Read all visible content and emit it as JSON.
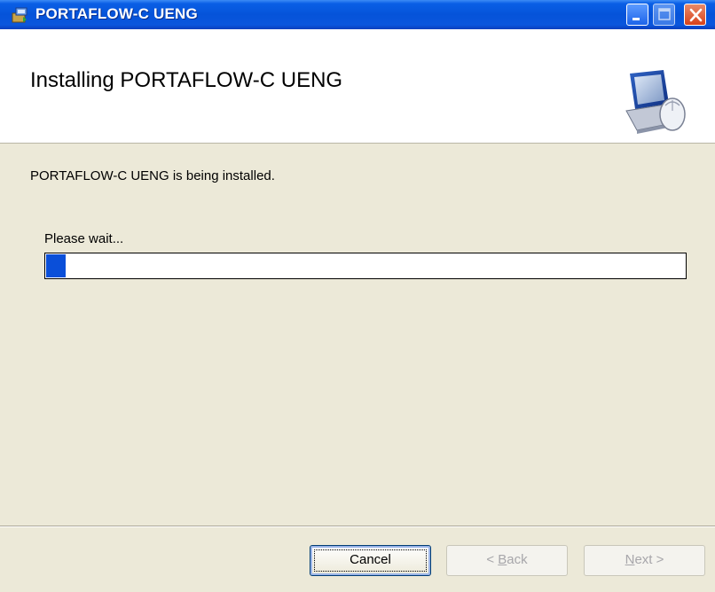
{
  "window": {
    "title": "PORTAFLOW-C UENG",
    "app_icon": "installer-package-icon",
    "controls": [
      "minimize-icon",
      "maximize-icon",
      "close-icon"
    ]
  },
  "header": {
    "title": "Installing PORTAFLOW-C UENG",
    "graphic": "computer-install-icon"
  },
  "main": {
    "status": "PORTAFLOW-C UENG is being installed.",
    "wait_label": "Please wait...",
    "progress_fraction": 0.03
  },
  "buttons": {
    "cancel": "Cancel",
    "back_prefix": "< ",
    "back_accel": "B",
    "back_rest": "ack",
    "next_accel": "N",
    "next_rest": "ext >"
  },
  "colors": {
    "titlebar": "#0553d9",
    "progress_fill": "#0a4fd9",
    "dialog_bg": "#ece9d8"
  }
}
